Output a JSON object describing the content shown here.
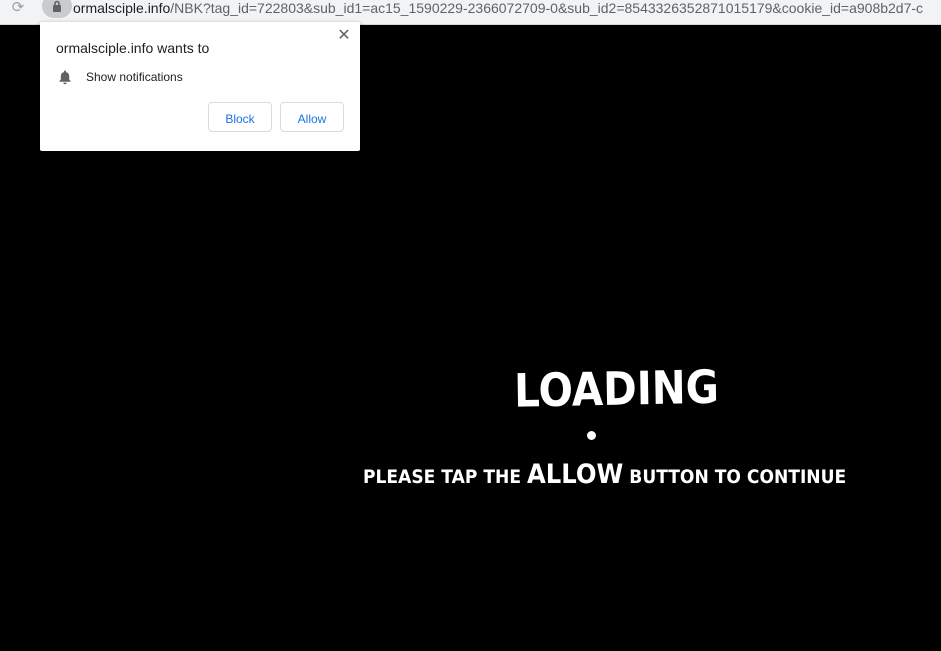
{
  "browser": {
    "url_host": "ormalsciple.info",
    "url_rest": "/NBK?tag_id=722803&sub_id1=ac15_1590229-2366072709-0&sub_id2=8543326352871015179&cookie_id=a908b2d7-c"
  },
  "notification_popup": {
    "title": "ormalsciple.info wants to",
    "permission_label": "Show notifications",
    "block_label": "Block",
    "allow_label": "Allow",
    "close_glyph": "✕"
  },
  "page": {
    "loading_text": "LOADING",
    "tagline_before": "PLEASE TAP THE ",
    "tagline_emphasis": "ALLOW",
    "tagline_after": " BUTTON TO CONTINUE"
  },
  "icons": {
    "reload": "reload-icon",
    "lock": "lock-icon",
    "bell": "bell-icon",
    "close": "close-icon"
  },
  "colors": {
    "background": "#000000",
    "button_text": "#1a73e8",
    "popup_background": "#ffffff"
  }
}
